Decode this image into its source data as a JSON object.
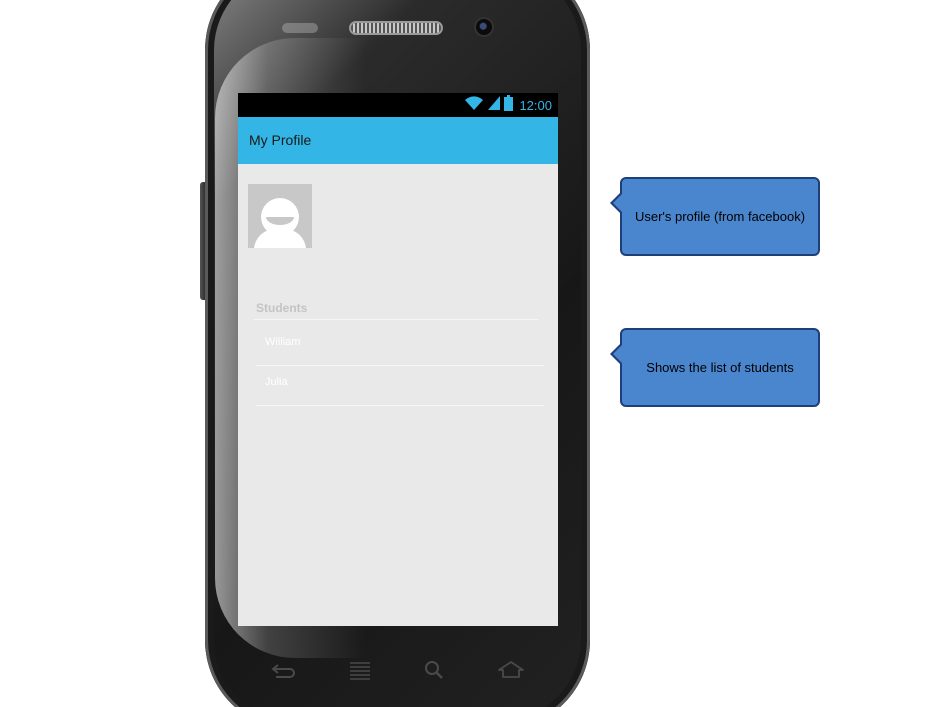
{
  "status_bar": {
    "time": "12:00",
    "icons": [
      "wifi-icon",
      "signal-icon",
      "battery-icon"
    ],
    "accent_color": "#33b5e5"
  },
  "action_bar": {
    "title": "My Profile",
    "color": "#33b5e5"
  },
  "profile": {
    "avatar_icon": "default-user-avatar-icon"
  },
  "students": {
    "header": "Students",
    "items": [
      {
        "name": "William"
      },
      {
        "name": "Julia"
      }
    ]
  },
  "nav_keys": [
    "back-icon",
    "menu-icon",
    "search-icon",
    "home-icon"
  ],
  "annotations": [
    {
      "text": "User's profile (from facebook)",
      "color": "#4a86cd"
    },
    {
      "text": "Shows the list of students",
      "color": "#4a86cd"
    }
  ]
}
